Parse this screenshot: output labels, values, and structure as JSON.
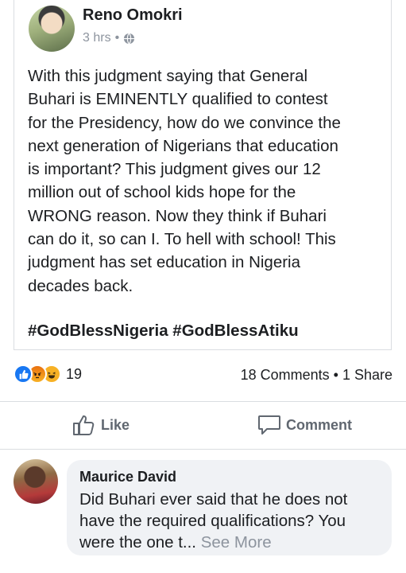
{
  "post": {
    "author": "Reno Omokri",
    "time": "3 hrs",
    "separator": "•",
    "privacy_icon": "globe-icon",
    "text": "With this judgment saying that General\nBuhari is EMINENTLY qualified to contest\nfor the Presidency, how do we convince the\nnext generation of Nigerians that education\nis important? This judgment gives our 12\nmillion out of school kids hope for the\nWRONG reason. Now they think if Buhari\ncan do it, so can I. To hell with school! This\njudgment has set education in Nigeria\ndecades back.",
    "hashtags": "#GodBlessNigeria #GodBlessAtiku"
  },
  "reactions": {
    "icons": [
      "like-reaction-icon",
      "angry-reaction-icon",
      "haha-reaction-icon"
    ],
    "count": "19",
    "comments": "18 Comments",
    "dot": "•",
    "shares": "1 Share"
  },
  "actions": {
    "like_label": "Like",
    "comment_label": "Comment"
  },
  "comment": {
    "author": "Maurice David",
    "text": "Did Buhari ever said that he does not have the required qualifications? You were the one t...",
    "see_more": "See More"
  },
  "colors": {
    "like_blue": "#1877f2",
    "secondary_text": "#8d949e",
    "bubble_bg": "#f0f2f5",
    "divider": "#dadde1"
  }
}
